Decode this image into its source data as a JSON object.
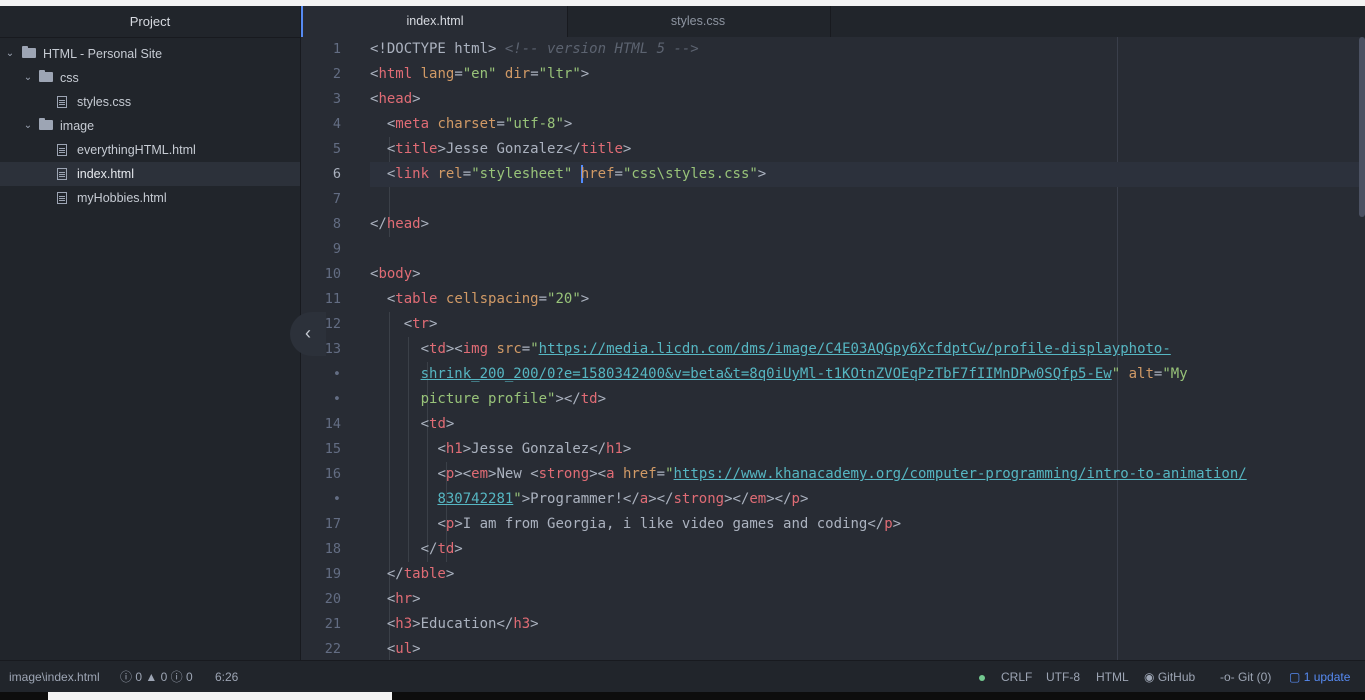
{
  "sidebar": {
    "title": "Project",
    "root": "HTML - Personal Site",
    "folders": {
      "css": "css",
      "image": "image"
    },
    "files": {
      "styles": "styles.css",
      "everything": "everythingHTML.html",
      "index": "index.html",
      "hobbies": "myHobbies.html"
    }
  },
  "tabs": [
    "index.html",
    "styles.css"
  ],
  "gutter": [
    "1",
    "2",
    "3",
    "4",
    "5",
    "6",
    "7",
    "8",
    "9",
    "10",
    "11",
    "12",
    "13",
    "•",
    "•",
    "14",
    "15",
    "16",
    "•",
    "17",
    "18",
    "19",
    "20",
    "21",
    "22"
  ],
  "code": {
    "l1": [
      "<!DOCTYPE html>",
      "<!-- version HTML 5 -->"
    ],
    "l2": [
      "<",
      "html",
      "lang",
      "=",
      "\"en\"",
      "dir",
      "=",
      "\"ltr\"",
      ">"
    ],
    "l3": [
      "<",
      "head",
      ">"
    ],
    "l4": [
      "<",
      "meta",
      "charset",
      "=",
      "\"utf-8\"",
      ">"
    ],
    "l5": [
      "<",
      "title",
      ">",
      "Jesse Gonzalez",
      "</",
      "title",
      ">"
    ],
    "l6": [
      "<",
      "link",
      "rel",
      "=",
      "\"stylesheet\"",
      "href",
      "=",
      "\"css\\styles.css\"",
      ">"
    ],
    "l8": [
      "</",
      "head",
      ">"
    ],
    "l10": [
      "<",
      "body",
      ">"
    ],
    "l11": [
      "<",
      "table",
      "cellspacing",
      "=",
      "\"20\"",
      ">"
    ],
    "l12": [
      "<",
      "tr",
      ">"
    ],
    "l13a": [
      "<",
      "td",
      "><",
      "img",
      "src",
      "=",
      "\"",
      "https://media.licdn.com/dms/image/C4E03AQGpy6XcfdptCw/profile-displayphoto-"
    ],
    "l13b": [
      "shrink_200_200/0?e=1580342400&v=beta&t=8q0iUyMl-t1KOtnZVOEqPzTbF7fIIMnDPw0SQfp5-Ew",
      "\"",
      "alt",
      "=",
      "\"My"
    ],
    "l13c": [
      "picture profile\"",
      "></",
      "td",
      ">"
    ],
    "l14": [
      "<",
      "td",
      ">"
    ],
    "l15": [
      "<",
      "h1",
      ">",
      "Jesse Gonzalez",
      "</",
      "h1",
      ">"
    ],
    "l16a": [
      "<",
      "p",
      "><",
      "em",
      ">",
      "New ",
      "<",
      "strong",
      "><",
      "a",
      "href",
      "=",
      "\"",
      "https://www.khanacademy.org/computer-programming/intro-to-animation/"
    ],
    "l16b": [
      "830742281",
      "\"",
      ">",
      "Programmer!",
      "</",
      "a",
      "></",
      "strong",
      "></",
      "em",
      "></",
      "p",
      ">"
    ],
    "l17": [
      "<",
      "p",
      ">",
      "I am from Georgia, i like video games and coding",
      "</",
      "p",
      ">"
    ],
    "l18": [
      "</",
      "td",
      ">"
    ],
    "l19": [
      "</",
      "table",
      ">"
    ],
    "l20": [
      "<",
      "hr",
      ">"
    ],
    "l21": [
      "<",
      "h3",
      ">",
      "Education",
      "</",
      "h3",
      ">"
    ],
    "l22": [
      "<",
      "ul",
      ">"
    ]
  },
  "status": {
    "path": "image\\index.html",
    "errors": "0",
    "warnings": "0",
    "infos": "0",
    "cursor": "6:26",
    "line_ending": "CRLF",
    "encoding": "UTF-8",
    "grammar": "HTML",
    "github": "GitHub",
    "git": "Git (0)",
    "update": "1 update"
  },
  "colors": {
    "tag": "#e06c75",
    "attr": "#d19a66",
    "string": "#98c379",
    "comment": "#5c6370",
    "url": "#56b6c2",
    "accent": "#568af2"
  }
}
